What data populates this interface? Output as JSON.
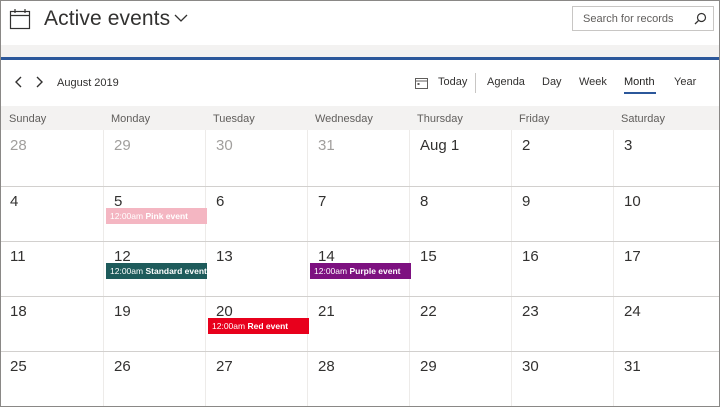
{
  "header": {
    "title": "Active events",
    "search_placeholder": "Search for records"
  },
  "toolbar": {
    "month_label": "August 2019",
    "today_label": "Today",
    "views": [
      {
        "label": "Agenda"
      },
      {
        "label": "Day"
      },
      {
        "label": "Week"
      },
      {
        "label": "Month",
        "active": true
      },
      {
        "label": "Year"
      }
    ]
  },
  "weekdays": [
    "Sunday",
    "Monday",
    "Tuesday",
    "Wednesday",
    "Thursday",
    "Friday",
    "Saturday"
  ],
  "weeks": [
    [
      "28",
      "29",
      "30",
      "31",
      "Aug 1",
      "2",
      "3"
    ],
    [
      "4",
      "5",
      "6",
      "7",
      "8",
      "9",
      "10"
    ],
    [
      "11",
      "12",
      "13",
      "14",
      "15",
      "16",
      "17"
    ],
    [
      "18",
      "19",
      "20",
      "21",
      "22",
      "23",
      "24"
    ],
    [
      "25",
      "26",
      "27",
      "28",
      "29",
      "30",
      "31"
    ]
  ],
  "outside_month": [
    [
      true,
      true,
      true,
      true,
      false,
      false,
      false
    ],
    [
      false,
      false,
      false,
      false,
      false,
      false,
      false
    ],
    [
      false,
      false,
      false,
      false,
      false,
      false,
      false
    ],
    [
      false,
      false,
      false,
      false,
      false,
      false,
      false
    ],
    [
      false,
      false,
      false,
      false,
      false,
      false,
      false
    ]
  ],
  "events": [
    {
      "week": 1,
      "day": 1,
      "time": "12:00am",
      "title": "Pink event",
      "color": "#f4b6c2"
    },
    {
      "week": 2,
      "day": 1,
      "time": "12:00am",
      "title": "Standard event",
      "color": "#1e5b5b"
    },
    {
      "week": 2,
      "day": 3,
      "time": "12:00am",
      "title": "Purple event",
      "color": "#7d1180"
    },
    {
      "week": 3,
      "day": 2,
      "time": "12:00am",
      "title": "Red event",
      "color": "#e8001c"
    }
  ],
  "colors": {
    "accent": "#2b579a",
    "header_band": "#f3f2f1"
  }
}
